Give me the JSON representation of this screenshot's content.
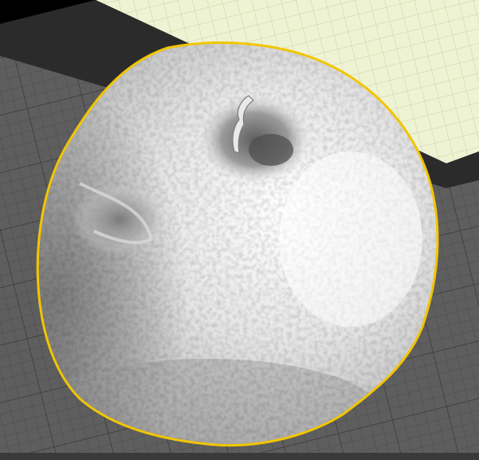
{
  "viewport": {
    "mode": "3d-model-preview",
    "model": {
      "shape": "apple",
      "selected": true
    },
    "colors": {
      "background": "#000000",
      "build_plate": "#5e5e5e",
      "build_plate_grid": "#4a4a4a",
      "back_wall": "#eef3d4",
      "back_wall_grid": "#c9d2a4",
      "plate_edge": "#2b2b2b",
      "model_base": "#e6e6e6",
      "model_shadow": "#8c8c8c",
      "selection_outline": "#f2c500"
    }
  }
}
